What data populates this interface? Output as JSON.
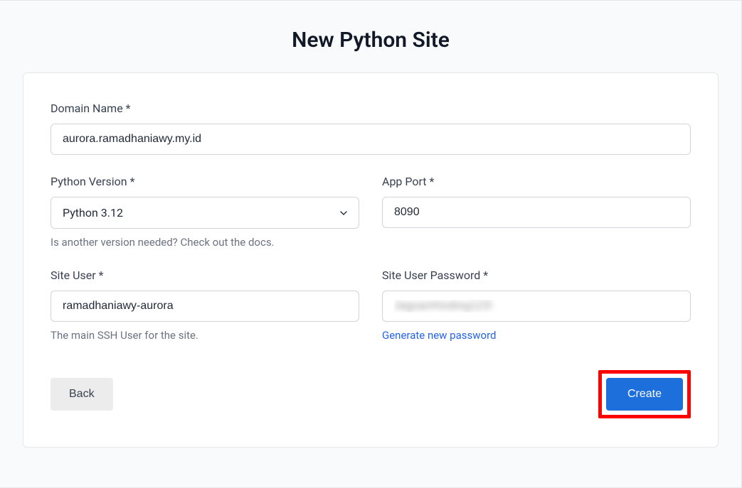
{
  "page": {
    "title": "New Python Site"
  },
  "form": {
    "domain": {
      "label": "Domain Name *",
      "value": "aurora.ramadhaniawy.my.id"
    },
    "python_version": {
      "label": "Python Version *",
      "selected": "Python 3.12",
      "help": "Is another version needed? Check out the docs."
    },
    "app_port": {
      "label": "App Port *",
      "value": "8090"
    },
    "site_user": {
      "label": "Site User *",
      "value": "ramadhaniawy-aurora",
      "help": "The main SSH User for the site."
    },
    "site_user_password": {
      "label": "Site User Password *",
      "value": "JagoanHosting123!",
      "link": "Generate new password"
    }
  },
  "buttons": {
    "back": "Back",
    "create": "Create"
  }
}
